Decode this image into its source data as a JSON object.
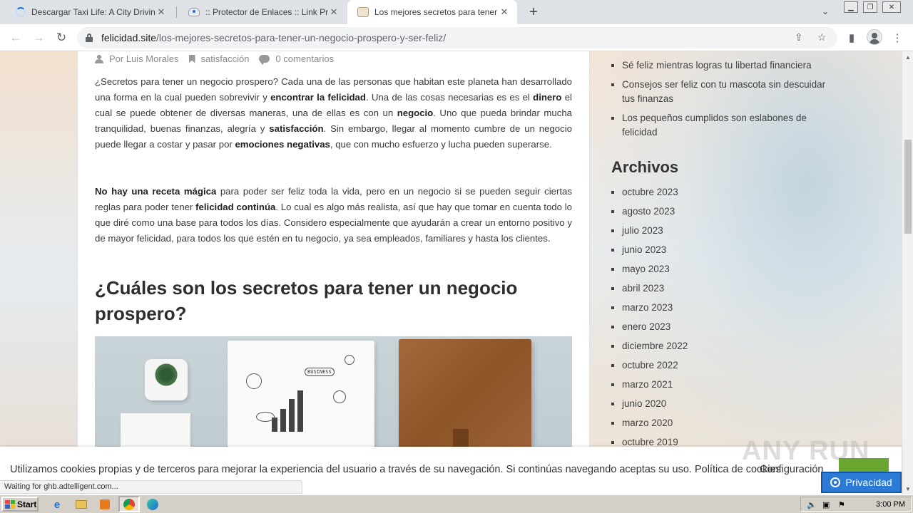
{
  "browser": {
    "tabs": [
      {
        "title": "Descargar Taxi Life: A City Driving Si",
        "icon": "loading-spinner-icon"
      },
      {
        "title": ":: Protector de Enlaces :: Link Protec",
        "icon": "site-icon"
      },
      {
        "title": "Los mejores secretos para tener un n",
        "icon": "site-icon"
      }
    ],
    "url_domain": "felicidad.site",
    "url_path": "/los-mejores-secretos-para-tener-un-negocio-prospero-y-ser-feliz/",
    "status_text": "Waiting for ghb.adtelligent.com..."
  },
  "article": {
    "meta": {
      "author": "Por Luis Morales",
      "category": "satisfacción",
      "comments": "0 comentarios"
    },
    "p1": [
      {
        "t": "¿Secretos para tener un negocio prospero? Cada una de las personas que habitan este planeta han desarrollado una forma en la cual pueden sobrevivir y ",
        "b": false
      },
      {
        "t": "encontrar la felicidad",
        "b": true
      },
      {
        "t": ". Una de las cosas necesarias es es el ",
        "b": false
      },
      {
        "t": "dinero",
        "b": true
      },
      {
        "t": " el cual se puede obtener de diversas maneras, una de ellas es con un ",
        "b": false
      },
      {
        "t": "negocio",
        "b": true
      },
      {
        "t": ". Uno que pueda brindar mucha tranquilidad, buenas finanzas, alegría y ",
        "b": false
      },
      {
        "t": "satisfacción",
        "b": true
      },
      {
        "t": ". Sin embargo, llegar al momento cumbre de un negocio puede llegar a costar y pasar por ",
        "b": false
      },
      {
        "t": "emociones negativas",
        "b": true
      },
      {
        "t": ", que con mucho esfuerzo y lucha pueden superarse.",
        "b": false
      }
    ],
    "p2": [
      {
        "t": "No hay una receta mágica",
        "b": true
      },
      {
        "t": " para poder ser feliz toda la vida, pero en un negocio si se pueden seguir ciertas reglas para poder tener ",
        "b": false
      },
      {
        "t": "felicidad continúa",
        "b": true
      },
      {
        "t": ". Lo cual es algo más realista, así que hay que tomar en cuenta todo lo que diré como una base para todos los días. Considero especialmente que ayudarán a crear un entorno positivo y de mayor felicidad, para todos los que estén en tu negocio, ya sea empleados, familiares y hasta los clientes.",
        "b": false
      }
    ],
    "heading": "¿Cuáles son los secretos para tener un negocio prospero?",
    "image_sketch_tag": "BUSINESS"
  },
  "sidebar": {
    "recent_posts": [
      "Sé feliz mientras logras tu libertad financiera",
      "Consejos ser feliz con tu mascota sin descuidar tus finanzas",
      "Los pequeños cumplidos son eslabones de felicidad"
    ],
    "archives_title": "Archivos",
    "archives": [
      "octubre 2023",
      "agosto 2023",
      "julio 2023",
      "junio 2023",
      "mayo 2023",
      "abril 2023",
      "marzo 2023",
      "enero 2023",
      "diciembre 2022",
      "octubre 2022",
      "marzo 2021",
      "junio 2020",
      "marzo 2020",
      "octubre 2019"
    ]
  },
  "cookie": {
    "text": "Utilizamos cookies propias y de terceros para mejorar la experiencia del usuario a través de su navegación. Si continúas navegando aceptas su uso. Política de cookies",
    "config_label": "Configuración",
    "privacy_label": "Privacidad",
    "accent": "#2b7bd6"
  },
  "watermark": "ANY RUN",
  "taskbar": {
    "start_label": "Start",
    "clock": "3:00 PM"
  }
}
